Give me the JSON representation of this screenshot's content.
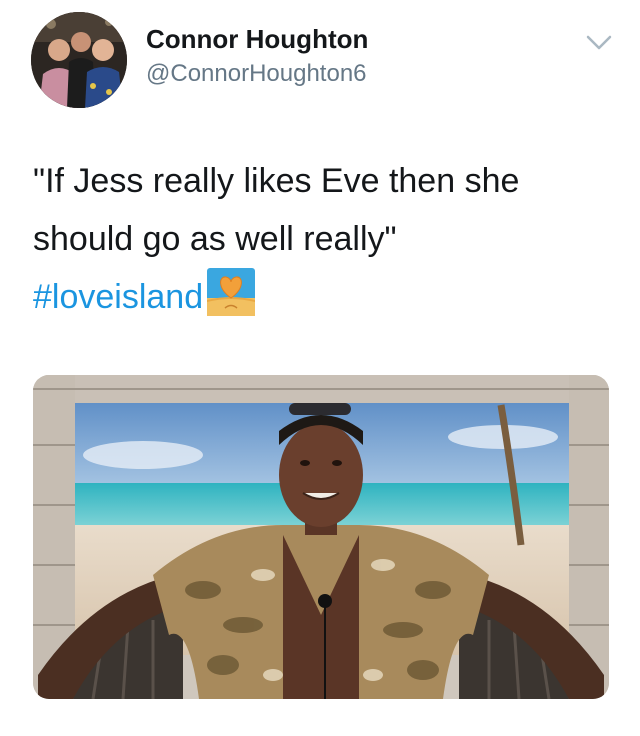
{
  "user": {
    "display_name": "Connor Houghton",
    "handle": "@ConnorHoughton6",
    "avatar_icon": "profile-photo"
  },
  "menu_icon": "chevron-down-icon",
  "tweet": {
    "line1": "\"If Jess really likes Eve then she",
    "line2": "should go as well really\"",
    "hashtag": "#loveisland",
    "hashtag_emoji": "love-island-heart-beach-icon"
  },
  "media": {
    "kind": "photo",
    "subject": "man in floral shirt on beach-hut set"
  },
  "colors": {
    "name": "#14171a",
    "handle": "#657786",
    "hashtag": "#1b95e0"
  }
}
